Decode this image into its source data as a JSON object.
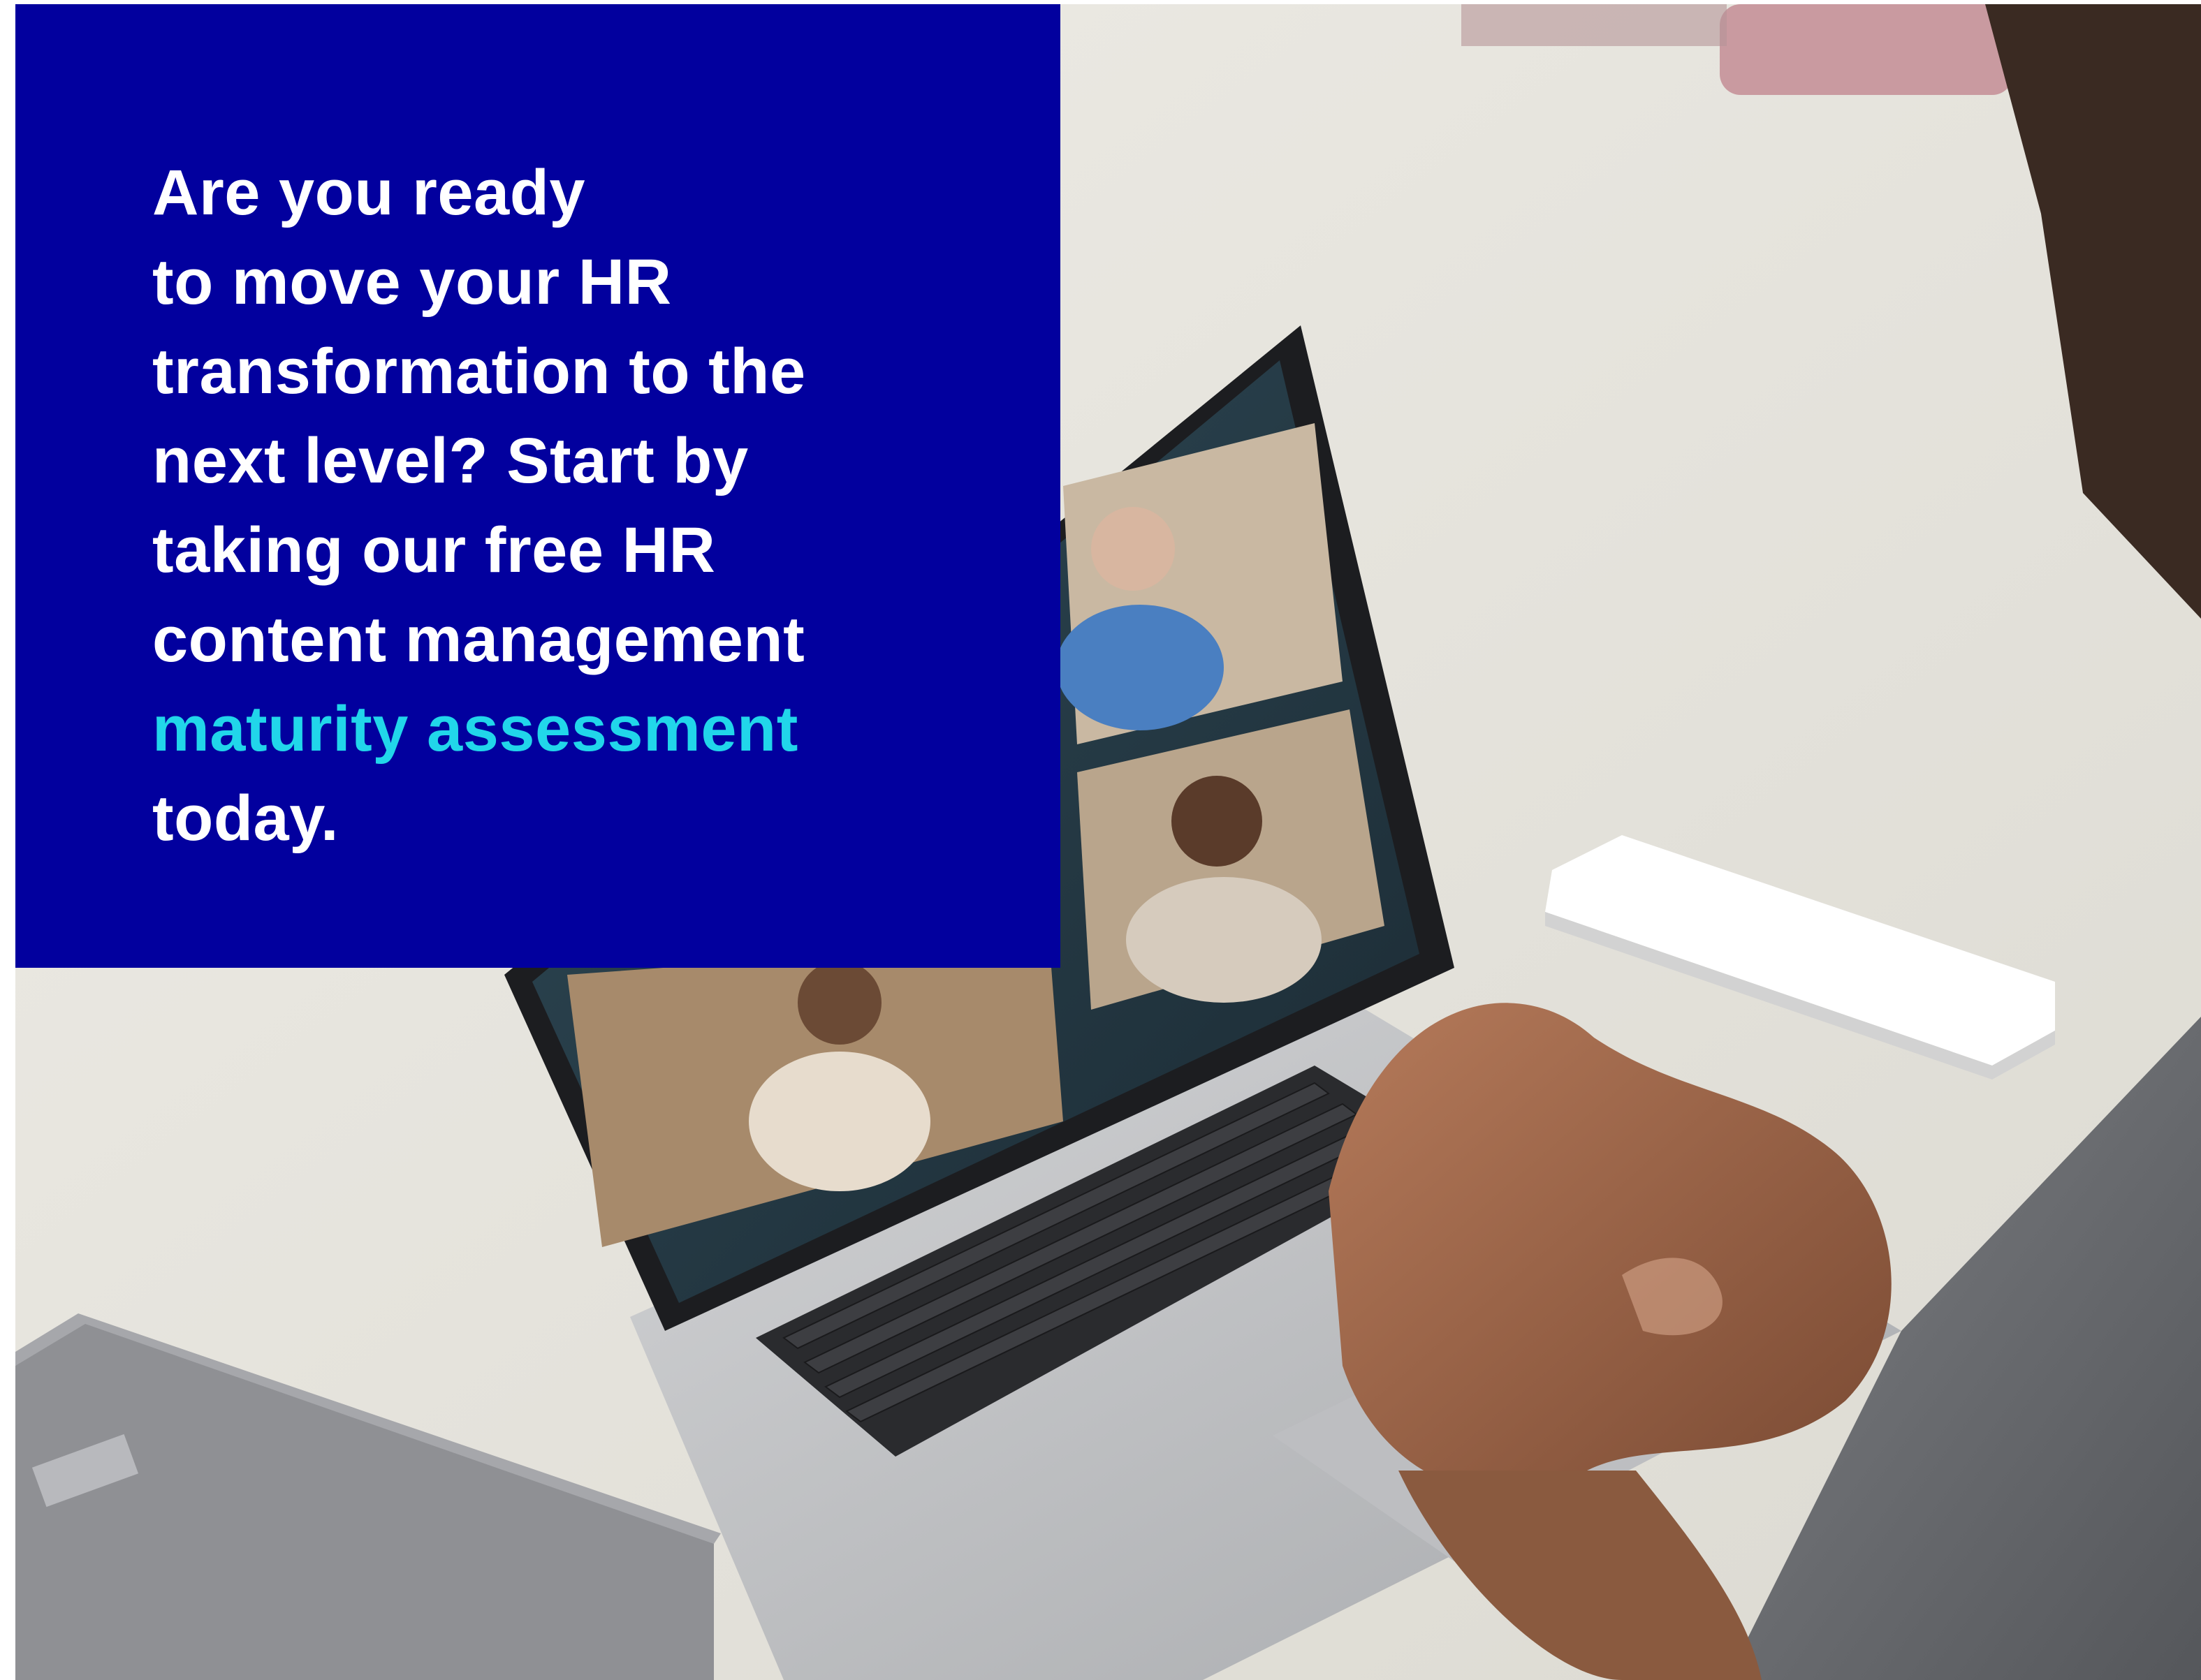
{
  "promo": {
    "line1": "Are you ready",
    "line2": "to move your HR",
    "line3": "transformation to the",
    "line4": "next level?  Start by",
    "line5": "taking our free HR",
    "line6": "content management",
    "highlight": "maturity assessment",
    "line8": "today."
  },
  "colors": {
    "box_background": "#02009e",
    "text": "#ffffff",
    "highlight": "#21d6ea",
    "table": "#e9e7e0"
  }
}
